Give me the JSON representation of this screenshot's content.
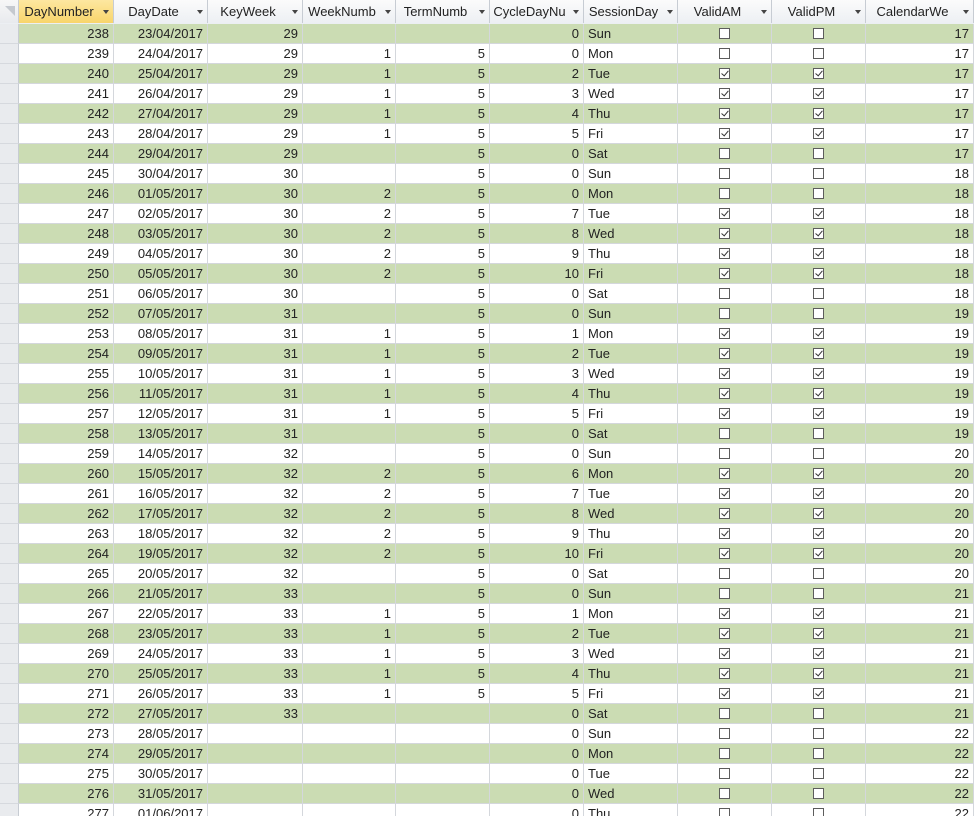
{
  "columns": [
    {
      "key": "daynumber",
      "label": "DayNumber",
      "align": "num"
    },
    {
      "key": "daydate",
      "label": "DayDate",
      "align": "num"
    },
    {
      "key": "keyweek",
      "label": "KeyWeek",
      "align": "num"
    },
    {
      "key": "weeknumber",
      "label": "WeekNumb",
      "align": "num"
    },
    {
      "key": "termnumber",
      "label": "TermNumb",
      "align": "num"
    },
    {
      "key": "cycledaynumber",
      "label": "CycleDayNu",
      "align": "num"
    },
    {
      "key": "sessionday",
      "label": "SessionDay",
      "align": "txt"
    },
    {
      "key": "validam",
      "label": "ValidAM",
      "align": "chk"
    },
    {
      "key": "validpm",
      "label": "ValidPM",
      "align": "chk"
    },
    {
      "key": "calendarweek",
      "label": "CalendarWe",
      "align": "num"
    }
  ],
  "selected_column": "daynumber",
  "colors": {
    "alt_row": "#cbdcb3",
    "header_selected": "#f8d56b"
  },
  "rows": [
    [
      "238",
      "23/04/2017",
      "29",
      "",
      "",
      "0",
      "Sun",
      false,
      false,
      "17"
    ],
    [
      "239",
      "24/04/2017",
      "29",
      "1",
      "5",
      "0",
      "Mon",
      false,
      false,
      "17"
    ],
    [
      "240",
      "25/04/2017",
      "29",
      "1",
      "5",
      "2",
      "Tue",
      true,
      true,
      "17"
    ],
    [
      "241",
      "26/04/2017",
      "29",
      "1",
      "5",
      "3",
      "Wed",
      true,
      true,
      "17"
    ],
    [
      "242",
      "27/04/2017",
      "29",
      "1",
      "5",
      "4",
      "Thu",
      true,
      true,
      "17"
    ],
    [
      "243",
      "28/04/2017",
      "29",
      "1",
      "5",
      "5",
      "Fri",
      true,
      true,
      "17"
    ],
    [
      "244",
      "29/04/2017",
      "29",
      "",
      "5",
      "0",
      "Sat",
      false,
      false,
      "17"
    ],
    [
      "245",
      "30/04/2017",
      "30",
      "",
      "5",
      "0",
      "Sun",
      false,
      false,
      "18"
    ],
    [
      "246",
      "01/05/2017",
      "30",
      "2",
      "5",
      "0",
      "Mon",
      false,
      false,
      "18"
    ],
    [
      "247",
      "02/05/2017",
      "30",
      "2",
      "5",
      "7",
      "Tue",
      true,
      true,
      "18"
    ],
    [
      "248",
      "03/05/2017",
      "30",
      "2",
      "5",
      "8",
      "Wed",
      true,
      true,
      "18"
    ],
    [
      "249",
      "04/05/2017",
      "30",
      "2",
      "5",
      "9",
      "Thu",
      true,
      true,
      "18"
    ],
    [
      "250",
      "05/05/2017",
      "30",
      "2",
      "5",
      "10",
      "Fri",
      true,
      true,
      "18"
    ],
    [
      "251",
      "06/05/2017",
      "30",
      "",
      "5",
      "0",
      "Sat",
      false,
      false,
      "18"
    ],
    [
      "252",
      "07/05/2017",
      "31",
      "",
      "5",
      "0",
      "Sun",
      false,
      false,
      "19"
    ],
    [
      "253",
      "08/05/2017",
      "31",
      "1",
      "5",
      "1",
      "Mon",
      true,
      true,
      "19"
    ],
    [
      "254",
      "09/05/2017",
      "31",
      "1",
      "5",
      "2",
      "Tue",
      true,
      true,
      "19"
    ],
    [
      "255",
      "10/05/2017",
      "31",
      "1",
      "5",
      "3",
      "Wed",
      true,
      true,
      "19"
    ],
    [
      "256",
      "11/05/2017",
      "31",
      "1",
      "5",
      "4",
      "Thu",
      true,
      true,
      "19"
    ],
    [
      "257",
      "12/05/2017",
      "31",
      "1",
      "5",
      "5",
      "Fri",
      true,
      true,
      "19"
    ],
    [
      "258",
      "13/05/2017",
      "31",
      "",
      "5",
      "0",
      "Sat",
      false,
      false,
      "19"
    ],
    [
      "259",
      "14/05/2017",
      "32",
      "",
      "5",
      "0",
      "Sun",
      false,
      false,
      "20"
    ],
    [
      "260",
      "15/05/2017",
      "32",
      "2",
      "5",
      "6",
      "Mon",
      true,
      true,
      "20"
    ],
    [
      "261",
      "16/05/2017",
      "32",
      "2",
      "5",
      "7",
      "Tue",
      true,
      true,
      "20"
    ],
    [
      "262",
      "17/05/2017",
      "32",
      "2",
      "5",
      "8",
      "Wed",
      true,
      true,
      "20"
    ],
    [
      "263",
      "18/05/2017",
      "32",
      "2",
      "5",
      "9",
      "Thu",
      true,
      true,
      "20"
    ],
    [
      "264",
      "19/05/2017",
      "32",
      "2",
      "5",
      "10",
      "Fri",
      true,
      true,
      "20"
    ],
    [
      "265",
      "20/05/2017",
      "32",
      "",
      "5",
      "0",
      "Sat",
      false,
      false,
      "20"
    ],
    [
      "266",
      "21/05/2017",
      "33",
      "",
      "5",
      "0",
      "Sun",
      false,
      false,
      "21"
    ],
    [
      "267",
      "22/05/2017",
      "33",
      "1",
      "5",
      "1",
      "Mon",
      true,
      true,
      "21"
    ],
    [
      "268",
      "23/05/2017",
      "33",
      "1",
      "5",
      "2",
      "Tue",
      true,
      true,
      "21"
    ],
    [
      "269",
      "24/05/2017",
      "33",
      "1",
      "5",
      "3",
      "Wed",
      true,
      true,
      "21"
    ],
    [
      "270",
      "25/05/2017",
      "33",
      "1",
      "5",
      "4",
      "Thu",
      true,
      true,
      "21"
    ],
    [
      "271",
      "26/05/2017",
      "33",
      "1",
      "5",
      "5",
      "Fri",
      true,
      true,
      "21"
    ],
    [
      "272",
      "27/05/2017",
      "33",
      "",
      "",
      "0",
      "Sat",
      false,
      false,
      "21"
    ],
    [
      "273",
      "28/05/2017",
      "",
      "",
      "",
      "0",
      "Sun",
      false,
      false,
      "22"
    ],
    [
      "274",
      "29/05/2017",
      "",
      "",
      "",
      "0",
      "Mon",
      false,
      false,
      "22"
    ],
    [
      "275",
      "30/05/2017",
      "",
      "",
      "",
      "0",
      "Tue",
      false,
      false,
      "22"
    ],
    [
      "276",
      "31/05/2017",
      "",
      "",
      "",
      "0",
      "Wed",
      false,
      false,
      "22"
    ],
    [
      "277",
      "01/06/2017",
      "",
      "",
      "",
      "0",
      "Thu",
      false,
      false,
      "22"
    ]
  ]
}
